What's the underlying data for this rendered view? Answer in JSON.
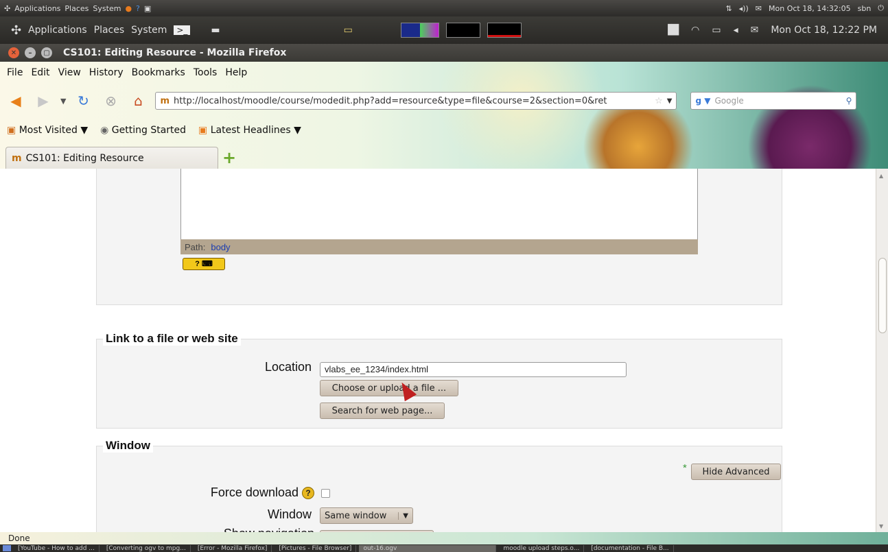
{
  "outer_panel": {
    "menus": [
      "Applications",
      "Places",
      "System"
    ],
    "clock": "Mon Oct 18, 14:32:05",
    "user": "sbn"
  },
  "inner_panel": {
    "menus": [
      "Applications",
      "Places",
      "System"
    ],
    "clock": "Mon Oct 18, 12:22 PM"
  },
  "window": {
    "title": "CS101: Editing Resource - Mozilla Firefox"
  },
  "menubar": [
    "File",
    "Edit",
    "View",
    "History",
    "Bookmarks",
    "Tools",
    "Help"
  ],
  "navigation": {
    "url": "http://localhost/moodle/course/modedit.php?add=resource&type=file&course=2&section=0&ret",
    "search_placeholder": "Google"
  },
  "bookmarks": [
    "Most Visited",
    "Getting Started",
    "Latest Headlines"
  ],
  "tab": {
    "label": "CS101: Editing Resource",
    "new_tab": "+"
  },
  "editor": {
    "path_label": "Path:",
    "path_value": "body"
  },
  "link_section": {
    "legend": "Link to a file or web site",
    "location_label": "Location",
    "location_value": "vlabs_ee_1234/index.html",
    "choose_button": "Choose or upload a file ...",
    "search_button": "Search for web page..."
  },
  "window_section": {
    "legend": "Window",
    "hide_advanced": "Hide Advanced",
    "advanced_marker": "*",
    "force_download_label": "Force download",
    "window_label": "Window",
    "window_value": "Same window",
    "show_navigation_label": "Show navigation"
  },
  "status": {
    "text": "Done"
  },
  "taskbar": [
    "[YouTube - How to add ...",
    "[Converting ogv to mpg...",
    "[Error - Mozilla Firefox]",
    "[Pictures - File Browser]",
    "out-16.ogv",
    "moodle upload steps.o...",
    "[documentation - File B..."
  ]
}
